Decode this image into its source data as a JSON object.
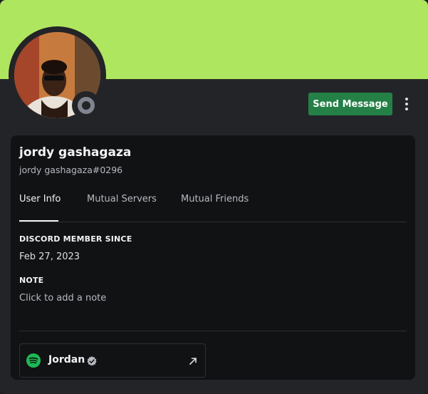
{
  "colors": {
    "banner": "#afe660",
    "send_button": "#248046",
    "status_offline": "#80848e",
    "spotify": "#1db954"
  },
  "header": {
    "send_message_label": "Send Message",
    "more_icon": "vertical-ellipsis"
  },
  "profile": {
    "display_name": "jordy gashagaza",
    "username": "jordy gashagaza#0296",
    "status": "offline"
  },
  "tabs": [
    {
      "label": "User Info",
      "active": true
    },
    {
      "label": "Mutual Servers",
      "active": false
    },
    {
      "label": "Mutual Friends",
      "active": false
    }
  ],
  "info": {
    "member_since_label": "DISCORD MEMBER SINCE",
    "member_since_value": "Feb 27, 2023",
    "note_label": "NOTE",
    "note_placeholder": "Click to add a note"
  },
  "connection": {
    "service_icon": "spotify",
    "name": "Jordan",
    "verified": true
  }
}
